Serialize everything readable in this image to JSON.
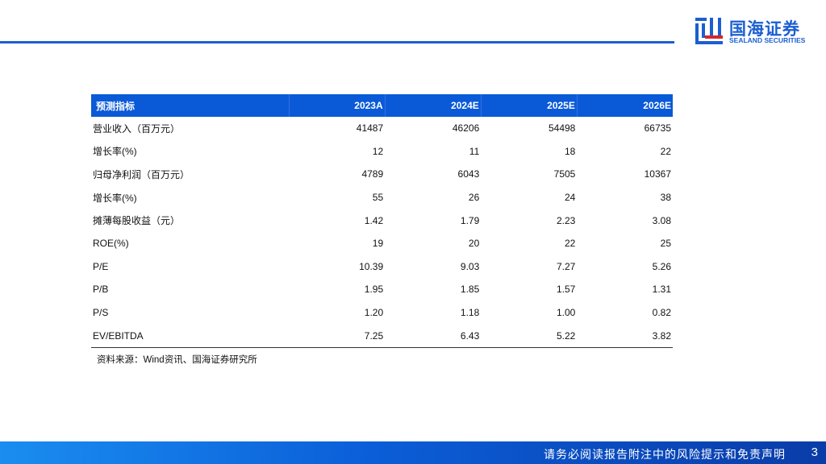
{
  "brand": {
    "name_cn": "国海证券",
    "name_en": "SEALAND SECURITIES",
    "color": "#1b5fd1"
  },
  "table": {
    "headers": [
      "预测指标",
      "2023A",
      "2024E",
      "2025E",
      "2026E"
    ],
    "rows": [
      [
        "营业收入（百万元）",
        "41487",
        "46206",
        "54498",
        "66735"
      ],
      [
        "增长率(%)",
        "12",
        "11",
        "18",
        "22"
      ],
      [
        "归母净利润（百万元）",
        "4789",
        "6043",
        "7505",
        "10367"
      ],
      [
        "增长率(%)",
        "55",
        "26",
        "24",
        "38"
      ],
      [
        "摊薄每股收益（元）",
        "1.42",
        "1.79",
        "2.23",
        "3.08"
      ],
      [
        "ROE(%)",
        "19",
        "20",
        "22",
        "25"
      ],
      [
        "P/E",
        "10.39",
        "9.03",
        "7.27",
        "5.26"
      ],
      [
        "P/B",
        "1.95",
        "1.85",
        "1.57",
        "1.31"
      ],
      [
        "P/S",
        "1.20",
        "1.18",
        "1.00",
        "0.82"
      ],
      [
        "EV/EBITDA",
        "7.25",
        "6.43",
        "5.22",
        "3.82"
      ]
    ]
  },
  "source": "资料来源：Wind资讯、国海证券研究所",
  "footer": {
    "disclaimer": "请务必阅读报告附注中的风险提示和免责声明",
    "page": "3"
  }
}
